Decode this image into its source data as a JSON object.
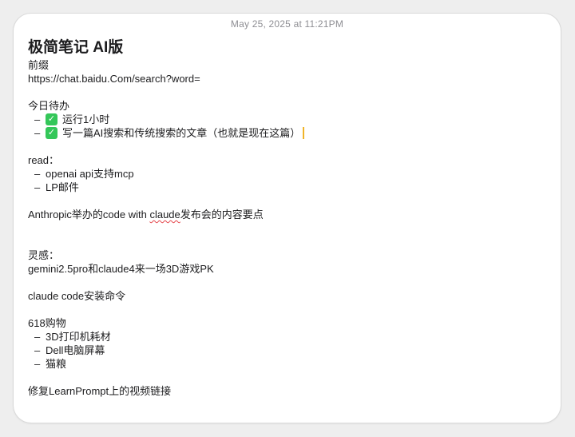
{
  "timestamp": "May 25, 2025 at 11:21PM",
  "note": {
    "title": "极简笔记 AI版",
    "prefix_label": "前缀",
    "prefix_url": "https://chat.baidu.Com/search?word=",
    "todo": {
      "heading": "今日待办",
      "items": [
        {
          "text": "运行1小时",
          "done": true
        },
        {
          "text": "写一篇AI搜索和传统搜索的文章（也就是现在这篇）",
          "done": true
        }
      ]
    },
    "read": {
      "heading": "read：",
      "items": [
        "openai api支持mcp",
        "LP邮件"
      ]
    },
    "anthropic_line": {
      "before": "Anthropic举办的code with ",
      "misspelled": "claude",
      "after": "发布会的内容要点"
    },
    "inspiration": {
      "heading": "灵感：",
      "text": "gemini2.5pro和claude4来一场3D游戏PK"
    },
    "claude_code_line": "claude code安装命令",
    "shopping": {
      "heading": "618购物",
      "items": [
        "3D打印机耗材",
        "Dell电脑屏幕",
        "猫粮"
      ]
    },
    "fix_line": "修复LearnPrompt上的视频链接"
  },
  "icons": {
    "check": "green-checkbox-icon"
  },
  "colors": {
    "check_green": "#34c759",
    "cursor": "#f0b429",
    "spellcheck": "#e5484d"
  }
}
